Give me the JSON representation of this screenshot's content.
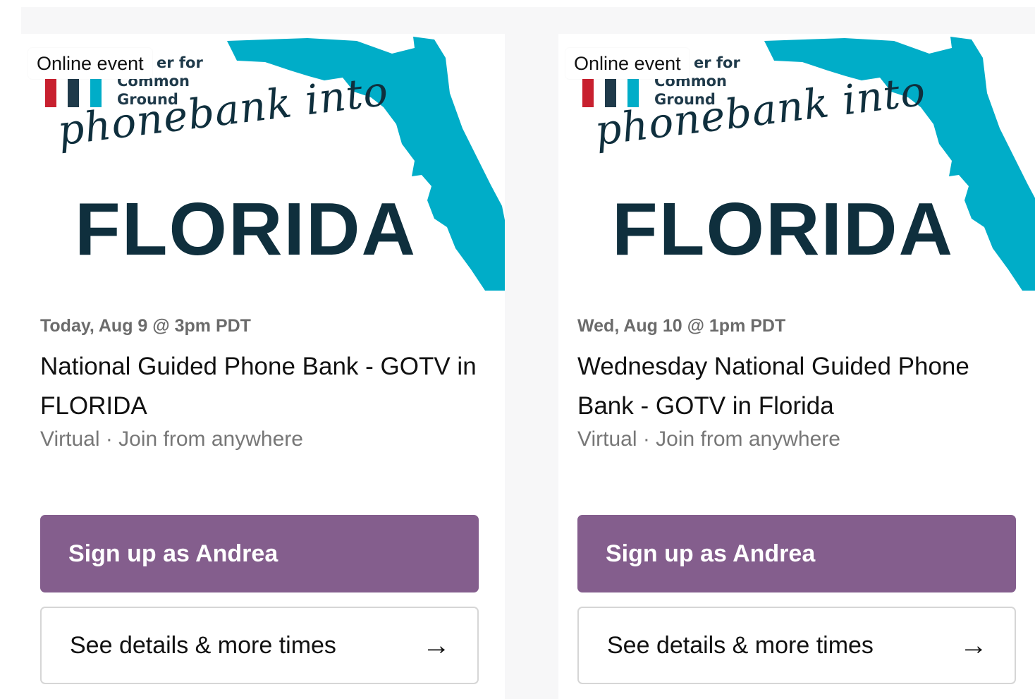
{
  "colors": {
    "accent_purple": "#845e8d",
    "florida_teal": "#00adc8",
    "navy_text": "#0f2f3d",
    "logo_red": "#c8202f"
  },
  "events": [
    {
      "badge": "Online event",
      "org_line1": "er for",
      "org_line2": "Common",
      "org_line3": "Ground",
      "script_text": "phonebank into",
      "state_text": "FLORIDA",
      "date": "Today, Aug 9 @ 3pm PDT",
      "title": "National Guided Phone Bank - GOTV in FLORIDA",
      "location": "Virtual · Join from anywhere",
      "signup_label": "Sign up as Andrea",
      "details_label": "See details & more times",
      "details_icon": "arrow-right-icon"
    },
    {
      "badge": "Online event",
      "org_line1": "er for",
      "org_line2": "Common",
      "org_line3": "Ground",
      "script_text": "phonebank into",
      "state_text": "FLORIDA",
      "date": "Wed, Aug 10 @ 1pm PDT",
      "title": "Wednesday National Guided Phone Bank - GOTV in Florida",
      "location": "Virtual · Join from anywhere",
      "signup_label": "Sign up as Andrea",
      "details_label": "See details & more times",
      "details_icon": "arrow-right-icon"
    }
  ]
}
